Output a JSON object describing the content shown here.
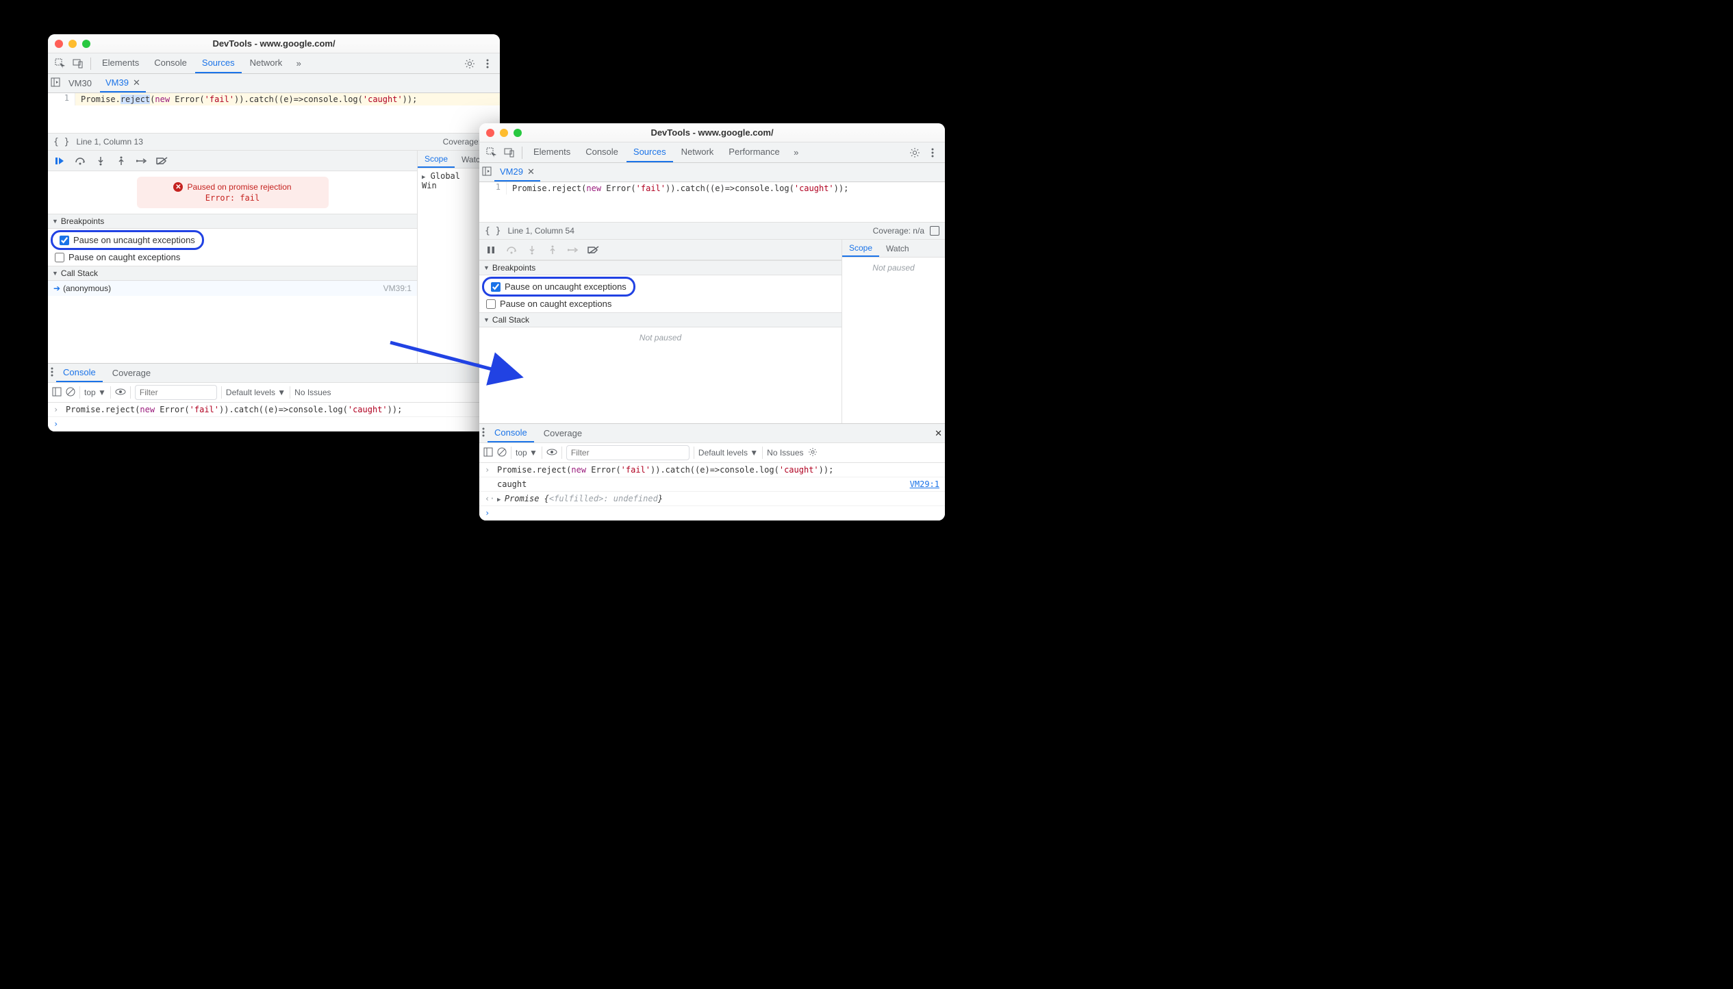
{
  "left": {
    "title": "DevTools - www.google.com/",
    "tabs": [
      "Elements",
      "Console",
      "Sources",
      "Network"
    ],
    "active_tab": "Sources",
    "more_glyph": "»",
    "file_tabs": [
      {
        "name": "VM30",
        "active": false,
        "closable": false
      },
      {
        "name": "VM39",
        "active": true,
        "closable": true
      }
    ],
    "code": {
      "line_no": "1",
      "segments": [
        {
          "t": "Promise.",
          "c": "id"
        },
        {
          "t": "reject",
          "c": "sel"
        },
        {
          "t": "(",
          "c": "id"
        },
        {
          "t": "new",
          "c": "kw"
        },
        {
          "t": " Error(",
          "c": "id"
        },
        {
          "t": "'fail'",
          "c": "str"
        },
        {
          "t": ")).",
          "c": "id"
        },
        {
          "t": "catch",
          "c": "fn"
        },
        {
          "t": "((e)=>console.log(",
          "c": "id"
        },
        {
          "t": "'caught'",
          "c": "str"
        },
        {
          "t": "));",
          "c": "id"
        }
      ]
    },
    "status": {
      "braces": "{ }",
      "pos": "Line 1, Column 13",
      "coverage": "Coverage: n/a"
    },
    "pause": {
      "title": "Paused on promise rejection",
      "detail": "Error: fail"
    },
    "sections": {
      "breakpoints": "Breakpoints",
      "callstack": "Call Stack"
    },
    "bp_items": [
      {
        "label": "Pause on uncaught exceptions",
        "checked": true,
        "highlight": true
      },
      {
        "label": "Pause on caught exceptions",
        "checked": false,
        "highlight": false
      }
    ],
    "callstack": [
      {
        "name": "(anonymous)",
        "loc": "VM39:1",
        "current": true
      }
    ],
    "scope": {
      "tabs": [
        "Scope",
        "Watch"
      ],
      "active": "Scope",
      "rows": [
        {
          "label": "Global",
          "value": "Win"
        }
      ]
    },
    "drawer": {
      "tabs": [
        "Console",
        "Coverage"
      ],
      "active": "Console"
    },
    "console_toolbar": {
      "context": "top",
      "filter_placeholder": "Filter",
      "levels": "Default levels",
      "issues": "No Issues"
    },
    "console_lines": [
      {
        "kind": "input",
        "segments": [
          {
            "t": "Promise.reject(",
            "c": "id"
          },
          {
            "t": "new",
            "c": "kw"
          },
          {
            "t": " Error(",
            "c": "id"
          },
          {
            "t": "'fail'",
            "c": "str"
          },
          {
            "t": ")).catch((e)=>console.log(",
            "c": "id"
          },
          {
            "t": "'caught'",
            "c": "str"
          },
          {
            "t": "));",
            "c": "id"
          }
        ]
      },
      {
        "kind": "prompt"
      }
    ]
  },
  "right": {
    "title": "DevTools - www.google.com/",
    "tabs": [
      "Elements",
      "Console",
      "Sources",
      "Network",
      "Performance"
    ],
    "active_tab": "Sources",
    "more_glyph": "»",
    "file_tabs": [
      {
        "name": "VM29",
        "active": true,
        "closable": true
      }
    ],
    "code": {
      "line_no": "1",
      "segments": [
        {
          "t": "Promise.reject(",
          "c": "id"
        },
        {
          "t": "new",
          "c": "kw"
        },
        {
          "t": " Error(",
          "c": "id"
        },
        {
          "t": "'fail'",
          "c": "str"
        },
        {
          "t": ")).",
          "c": "id"
        },
        {
          "t": "catch",
          "c": "fn"
        },
        {
          "t": "((e)=>console.log(",
          "c": "id"
        },
        {
          "t": "'caught'",
          "c": "str"
        },
        {
          "t": "));",
          "c": "id"
        }
      ]
    },
    "status": {
      "braces": "{ }",
      "pos": "Line 1, Column 54",
      "coverage": "Coverage: n/a"
    },
    "sections": {
      "breakpoints": "Breakpoints",
      "callstack": "Call Stack"
    },
    "bp_items": [
      {
        "label": "Pause on uncaught exceptions",
        "checked": true,
        "highlight": true
      },
      {
        "label": "Pause on caught exceptions",
        "checked": false,
        "highlight": false
      }
    ],
    "callstack_empty": "Not paused",
    "scope": {
      "tabs": [
        "Scope",
        "Watch"
      ],
      "active": "Scope",
      "empty": "Not paused"
    },
    "drawer": {
      "tabs": [
        "Console",
        "Coverage"
      ],
      "active": "Console"
    },
    "console_toolbar": {
      "context": "top",
      "filter_placeholder": "Filter",
      "levels": "Default levels",
      "issues": "No Issues"
    },
    "console_lines": [
      {
        "kind": "input",
        "segments": [
          {
            "t": "Promise.reject(",
            "c": "id"
          },
          {
            "t": "new",
            "c": "kw"
          },
          {
            "t": " Error(",
            "c": "id"
          },
          {
            "t": "'fail'",
            "c": "str"
          },
          {
            "t": ")).catch((e)=>console.log(",
            "c": "id"
          },
          {
            "t": "'caught'",
            "c": "str"
          },
          {
            "t": "));",
            "c": "id"
          }
        ]
      },
      {
        "kind": "log",
        "text": "caught",
        "link": "VM29:1"
      },
      {
        "kind": "result",
        "segments": [
          {
            "t": "Promise {",
            "c": "it"
          },
          {
            "t": "<fulfilled>",
            "c": "it-gray"
          },
          {
            "t": ": undefined",
            "c": "it-gray2"
          },
          {
            "t": "}",
            "c": "it"
          }
        ]
      },
      {
        "kind": "prompt"
      }
    ]
  }
}
